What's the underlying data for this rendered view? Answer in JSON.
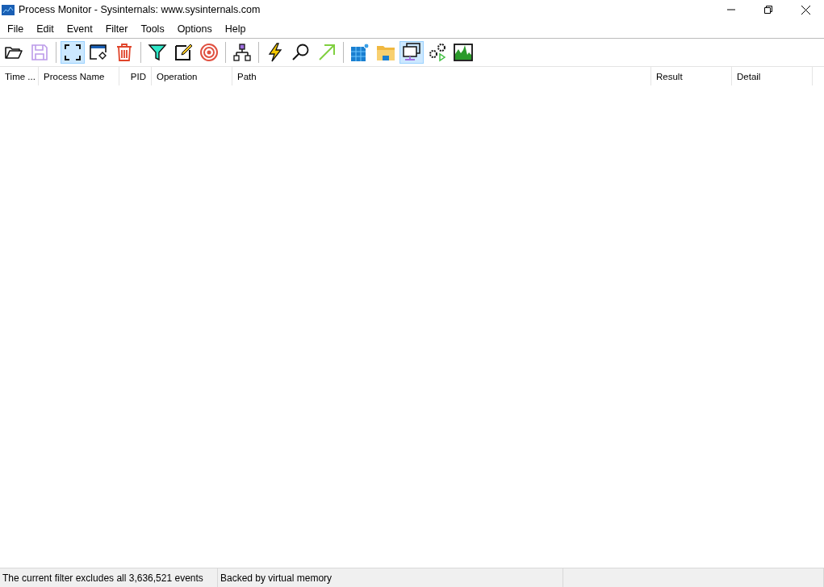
{
  "window": {
    "title": "Process Monitor - Sysinternals: www.sysinternals.com"
  },
  "menu": [
    "File",
    "Edit",
    "Event",
    "Filter",
    "Tools",
    "Options",
    "Help"
  ],
  "toolbar": [
    [
      {
        "selected": false,
        "disabled": false
      },
      {
        "selected": false,
        "disabled": true
      }
    ],
    [
      {
        "selected": true,
        "disabled": false
      },
      {
        "selected": false,
        "disabled": false
      },
      {
        "selected": false,
        "disabled": false
      }
    ],
    [
      {
        "selected": false,
        "disabled": false
      },
      {
        "selected": false,
        "disabled": false
      },
      {
        "selected": false,
        "disabled": false
      }
    ],
    [
      {
        "selected": false,
        "disabled": false
      }
    ],
    [
      {
        "selected": false,
        "disabled": false
      },
      {
        "selected": false,
        "disabled": false
      },
      {
        "selected": false,
        "disabled": false
      }
    ],
    [
      {
        "selected": false,
        "disabled": false
      },
      {
        "selected": false,
        "disabled": false
      },
      {
        "selected": true,
        "disabled": false
      },
      {
        "selected": false,
        "disabled": false
      },
      {
        "selected": false,
        "disabled": false
      }
    ]
  ],
  "table": {
    "columns": [
      "Time ...",
      "Process Name",
      "PID",
      "Operation",
      "Path",
      "Result",
      "Detail"
    ]
  },
  "status_bar": [
    "The current filter excludes all 3,636,521 events",
    "Backed by virtual memory"
  ]
}
